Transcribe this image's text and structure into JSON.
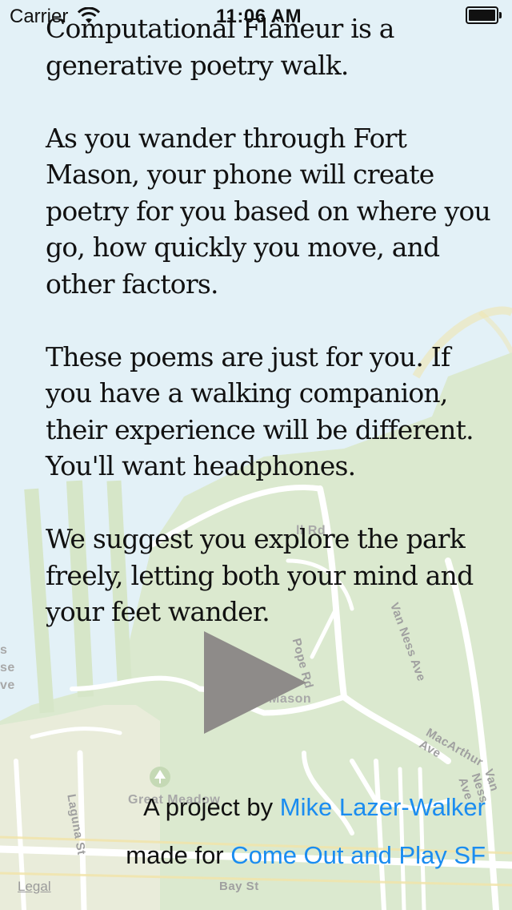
{
  "status_bar": {
    "carrier": "Carrier",
    "time": "11:06 AM"
  },
  "intro": {
    "paragraphs": [
      "Computational Flâneur is a generative poetry walk.",
      "As you wander through Fort Mason, your phone will create poetry for you based on where you go, how quickly you move, and other factors.",
      "These poems are just for you. If you have a walking companion, their experience will be different. You'll want headphones.",
      "We suggest you explore the park freely, letting both your mind and your feet wander."
    ]
  },
  "play_button": {
    "icon": "play-icon",
    "color": "#8e8b89"
  },
  "credits": {
    "line1_prefix": "A project by ",
    "line1_link": "Mike Lazer-Walker",
    "line2_prefix": "made for ",
    "line2_link": "Come Out and Play SF"
  },
  "map": {
    "labels": {
      "van_ness_ave_1": "Van Ness Ave",
      "pope_rd": "Pope Rd",
      "fort_mason": "Mason",
      "macarthur_ave": "MacArthur Ave",
      "great_meadow": "Great Meadow",
      "laguna_st": "Laguna St",
      "bay_st": "Bay St",
      "van_ness_ave_2": "Van Ness Ave",
      "left_fragment_1": "s",
      "left_fragment_2": "se",
      "left_fragment_3": "ve",
      "upper_fragment": "ll Rd"
    },
    "legal": "Legal"
  },
  "colors": {
    "water": "#e3f1f7",
    "park": "#dbe9cf",
    "road": "#ffffff",
    "link": "#1a8cf0",
    "play": "#8e8b89"
  }
}
